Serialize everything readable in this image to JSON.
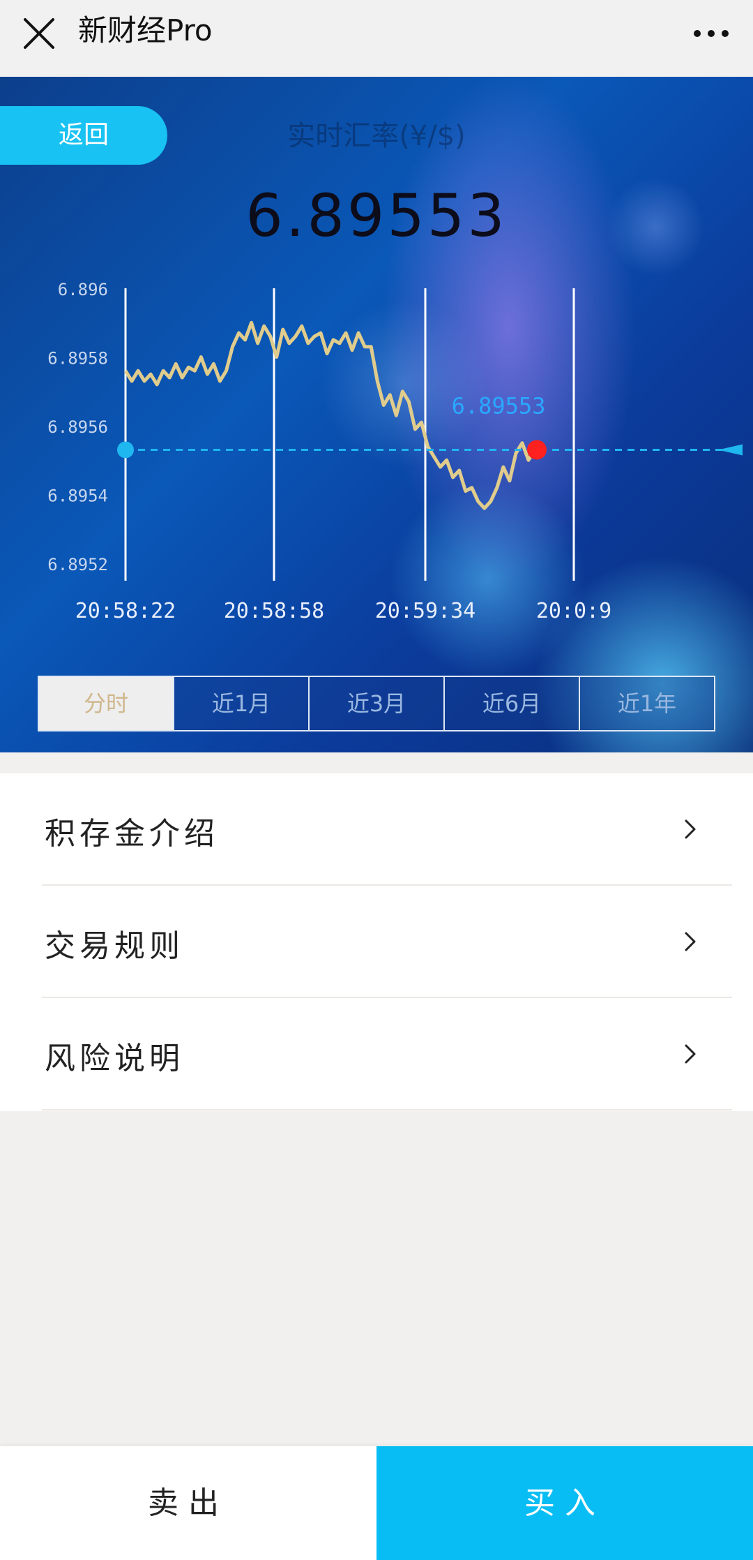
{
  "nav": {
    "title": "新财经Pro",
    "close_icon": "close-icon",
    "more_icon": "more-icon"
  },
  "hero": {
    "back_label": "返回",
    "subtitle": "实时汇率(¥/$)",
    "rate": "6.89553",
    "tabs": [
      {
        "label": "分时",
        "active": true
      },
      {
        "label": "近1月",
        "active": false
      },
      {
        "label": "近3月",
        "active": false
      },
      {
        "label": "近6月",
        "active": false
      },
      {
        "label": "近1年",
        "active": false
      }
    ]
  },
  "chart_data": {
    "type": "line",
    "title": "",
    "xlabel": "",
    "ylabel": "",
    "x_ticks": [
      "20:58:22",
      "20:58:58",
      "20:59:34",
      "20:0:9"
    ],
    "y_ticks": [
      "6.896",
      "6.8958",
      "6.8956",
      "6.8954",
      "6.8952"
    ],
    "ylim": [
      6.8952,
      6.896
    ],
    "current_value_label": "6.89553",
    "reference_value": 6.89553,
    "series": [
      {
        "values": [
          6.89576,
          6.89573,
          6.89576,
          6.89573,
          6.89575,
          6.89572,
          6.89576,
          6.89574,
          6.89578,
          6.89574,
          6.89577,
          6.89576,
          6.8958,
          6.89575,
          6.89578,
          6.89573,
          6.89576,
          6.89583,
          6.89587,
          6.89585,
          6.8959,
          6.89584,
          6.89589,
          6.89586,
          6.8958,
          6.89588,
          6.89584,
          6.89586,
          6.89589,
          6.89584,
          6.89586,
          6.89587,
          6.89581,
          6.89585,
          6.89584,
          6.89587,
          6.89582,
          6.89587,
          6.89583,
          6.89583,
          6.89573,
          6.89566,
          6.89569,
          6.89563,
          6.8957,
          6.89567,
          6.89559,
          6.89561,
          6.89554,
          6.89551,
          6.89548,
          6.8955,
          6.89545,
          6.89547,
          6.89541,
          6.89542,
          6.89538,
          6.89536,
          6.89538,
          6.89542,
          6.89548,
          6.89544,
          6.89552,
          6.89555,
          6.8955,
          6.89553
        ]
      }
    ],
    "colors": {
      "line": "#e0cc8c",
      "dash": "#1fb7f0",
      "end_dot": "#ff2020",
      "start_dot": "#1fb7f0",
      "grid": "#ffffff",
      "tick": "#c8d6ee"
    }
  },
  "menu": [
    {
      "label": "积存金介绍",
      "icon": "chevron-right-icon"
    },
    {
      "label": "交易规则",
      "icon": "chevron-right-icon"
    },
    {
      "label": "风险说明",
      "icon": "chevron-right-icon"
    }
  ],
  "bottom": {
    "sell_label": "卖出",
    "buy_label": "买入"
  }
}
